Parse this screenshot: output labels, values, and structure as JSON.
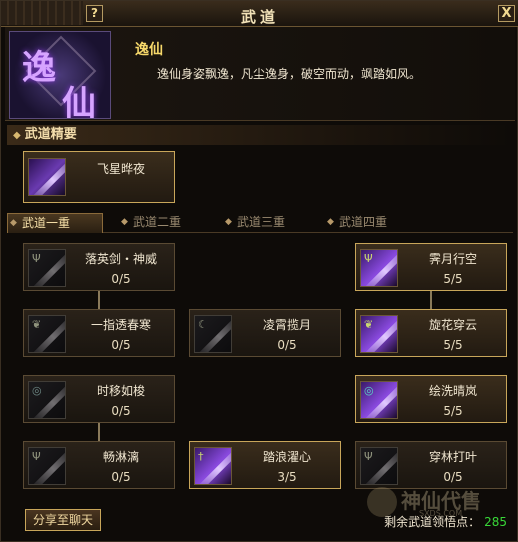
{
  "window": {
    "title": "武道",
    "help_label": "?",
    "close_label": "X"
  },
  "header": {
    "emblem_chars": [
      "逸",
      "仙"
    ],
    "skill_name": "逸仙",
    "skill_desc": "逸仙身姿飘逸，凡尘逸身，破空而动，飒踏如风。"
  },
  "essence": {
    "heading": "武道精要",
    "card": {
      "name": "飞星晔夜",
      "icon": "flying-star-icon"
    }
  },
  "tabs": [
    {
      "label": "武道一重",
      "active": true
    },
    {
      "label": "武道二重",
      "active": false
    },
    {
      "label": "武道三重",
      "active": false
    },
    {
      "label": "武道四重",
      "active": false
    }
  ],
  "skills": [
    {
      "name": "落英剑・神威",
      "count": "0/5",
      "icon": "trident-icon"
    },
    {
      "name": "霁月行空",
      "count": "5/5",
      "icon": "trident-icon"
    },
    {
      "name": "一指透春寒",
      "count": "0/5",
      "icon": "leaf-icon"
    },
    {
      "name": "凌霄揽月",
      "count": "0/5",
      "icon": "moon-icon"
    },
    {
      "name": "旋花穿云",
      "count": "5/5",
      "icon": "leaf-icon"
    },
    {
      "name": "时移如梭",
      "count": "0/5",
      "icon": "swirl-icon"
    },
    {
      "name": "绘洗晴岚",
      "count": "5/5",
      "icon": "swirl-icon"
    },
    {
      "name": "畅淋漓",
      "count": "0/5",
      "icon": "trident-icon"
    },
    {
      "name": "踏浪濯心",
      "count": "3/5",
      "icon": "dagger-icon"
    },
    {
      "name": "穿林打叶",
      "count": "0/5",
      "icon": "trident-icon"
    }
  ],
  "footer": {
    "share_label": "分享至聊天",
    "points_label": "剩余武道领悟点：",
    "points_value": "285"
  },
  "watermark": {
    "text": "神仙代售",
    "sub": "SXDS.COM"
  }
}
